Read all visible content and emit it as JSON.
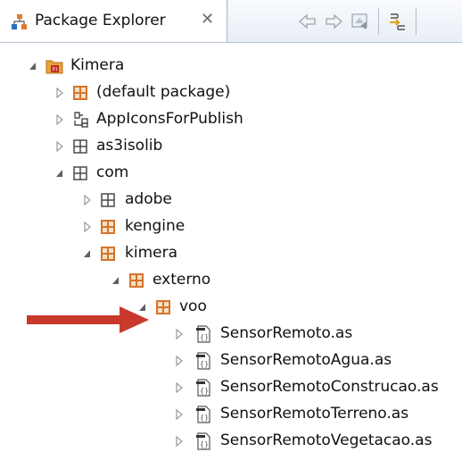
{
  "panel": {
    "title": "Package Explorer",
    "close_glyph": "✕",
    "toolbar": [
      "back-icon",
      "forward-icon",
      "home-icon",
      "link-with-editor-icon"
    ]
  },
  "tree": [
    {
      "label": "Kimera",
      "expanded": true,
      "icon": "flex-project-icon"
    },
    {
      "label": "(default package)",
      "expanded": false,
      "icon": "package-orange-icon"
    },
    {
      "label": "AppIconsForPublish",
      "expanded": false,
      "icon": "folder-tree-icon"
    },
    {
      "label": "as3isolib",
      "expanded": false,
      "icon": "package-empty-icon"
    },
    {
      "label": "com",
      "expanded": true,
      "icon": "package-empty-icon"
    },
    {
      "label": "adobe",
      "expanded": false,
      "icon": "package-empty-icon"
    },
    {
      "label": "kengine",
      "expanded": false,
      "icon": "package-orange-icon"
    },
    {
      "label": "kimera",
      "expanded": true,
      "icon": "package-orange-icon"
    },
    {
      "label": "externo",
      "expanded": true,
      "icon": "package-orange-icon"
    },
    {
      "label": "voo",
      "expanded": true,
      "icon": "package-orange-icon"
    },
    {
      "label": "SensorRemoto.as",
      "expanded": false,
      "icon": "actionscript-file-icon"
    },
    {
      "label": "SensorRemotoAgua.as",
      "expanded": false,
      "icon": "actionscript-file-icon"
    },
    {
      "label": "SensorRemotoConstrucao.as",
      "expanded": false,
      "icon": "actionscript-file-icon"
    },
    {
      "label": "SensorRemotoTerreno.as",
      "expanded": false,
      "icon": "actionscript-file-icon"
    },
    {
      "label": "SensorRemotoVegetacao.as",
      "expanded": false,
      "icon": "actionscript-file-icon"
    }
  ],
  "colors": {
    "accent_arrow": "#c8392b",
    "package_orange": "#d4752c",
    "package_empty": "#4a4a4a",
    "twisty": "#9a9a9a"
  }
}
